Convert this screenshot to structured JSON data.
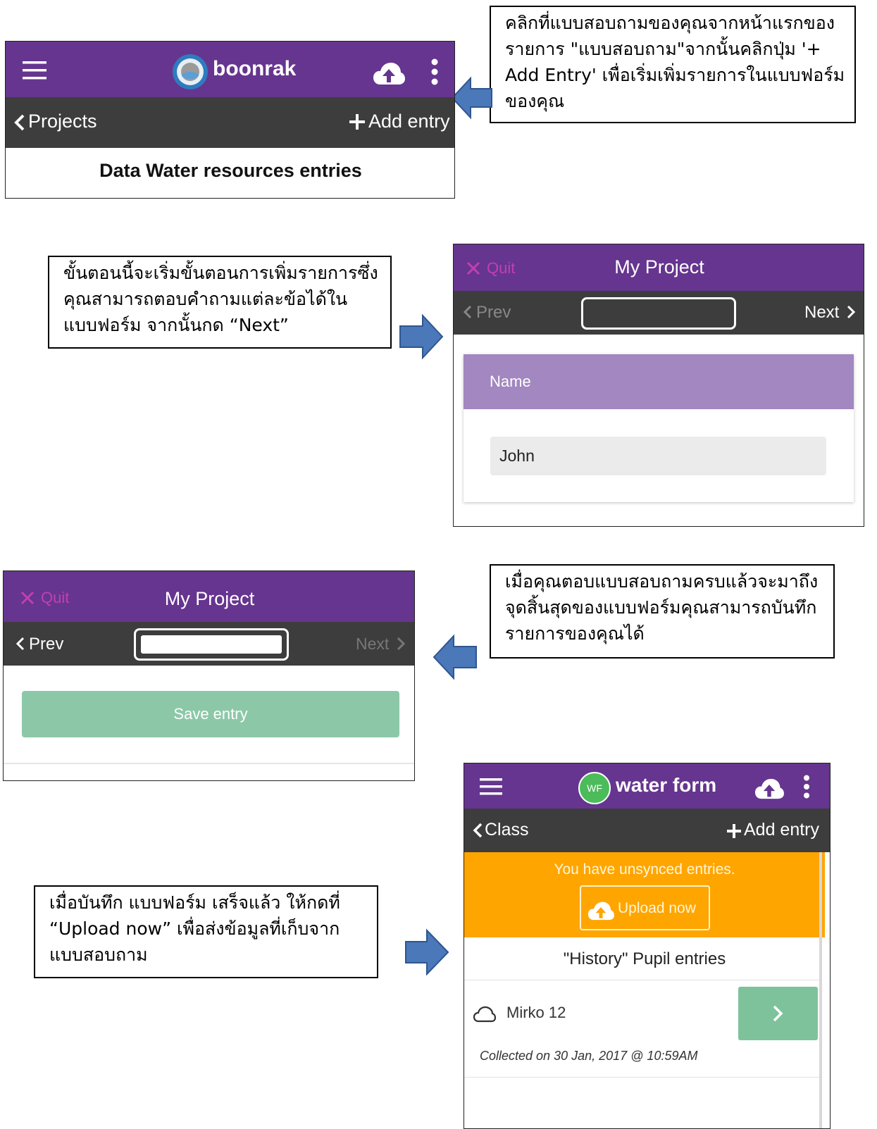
{
  "callouts": {
    "one": [
      "คลิกที่แบบสอบถามของคุณจากหน้าแรกของ",
      "รายการ \"แบบสอบถาม\"จากนั้นคลิกปุ่ม '+",
      "Add Entry' เพื่อเริ่มเพิ่มรายการในแบบฟอร์ม",
      "ของคุณ"
    ],
    "two": [
      "ขั้นตอนนี้จะเริ่มขั้นตอนการเพิ่มรายการซึ่ง",
      "คุณสามารถตอบคำถามแต่ละข้อได้ใน",
      "แบบฟอร์ม จากนั้นกด “Next”"
    ],
    "three": [
      "เมื่อคุณตอบแบบสอบถามครบแล้วจะมาถึง",
      "จุดสิ้นสุดของแบบฟอร์มคุณสามารถบันทึก",
      "รายการของคุณได้"
    ],
    "four": [
      "เมื่อบันทึก แบบฟอร์ม เสร็จแล้ว ให้กดที่",
      "“Upload now”  เพื่อส่งข้อมูลที่เก็บจาก",
      "แบบสอบถาม"
    ]
  },
  "screen1": {
    "app_name": "boonrak",
    "back_label": "Projects",
    "add_entry": "Add entry",
    "title": "Data Water resources entries"
  },
  "screen2": {
    "quit": "Quit",
    "project": "My Project",
    "prev": "Prev",
    "next": "Next",
    "question": "Name",
    "answer": "John"
  },
  "screen3": {
    "quit": "Quit",
    "project": "My Project",
    "prev": "Prev",
    "next": "Next",
    "save": "Save entry"
  },
  "screen4": {
    "avatar": "WF",
    "app_name": "water form",
    "back_label": "Class",
    "add_entry": "Add entry",
    "unsynced": "You have unsynced entries.",
    "upload": "Upload now",
    "list_title": "\"History\" Pupil entries",
    "entry_name": "Mirko 12",
    "collected": "Collected on 30 Jan, 2017 @ 10:59AM"
  },
  "colors": {
    "header_purple": "#66358f",
    "toolbar_dark": "#3d3d3d",
    "question_purple": "#a287c0",
    "save_green": "#8cc8a8",
    "unsynced_orange": "#ffa500",
    "arrow_blue": "#4a78b8"
  },
  "icons": [
    "menu-icon",
    "cloud-upload-icon",
    "more-vert-icon",
    "chevron-left-icon",
    "chevron-right-icon",
    "plus-icon",
    "close-icon",
    "cloud-icon",
    "arrow-icon"
  ]
}
